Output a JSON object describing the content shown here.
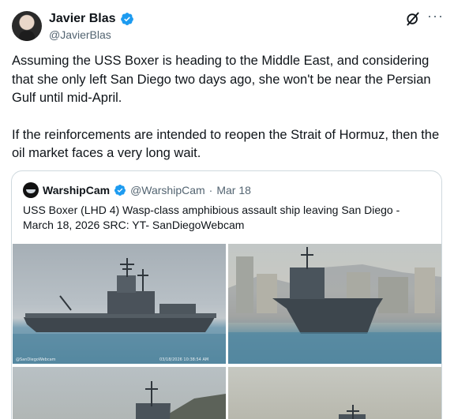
{
  "author": {
    "name": "Javier Blas",
    "handle": "@JavierBlas"
  },
  "tweet": {
    "paragraph1": "Assuming the USS Boxer is heading to the Middle East, and considering that she only left San Diego two days ago, she won't be near the Persian Gulf until mid-April.",
    "paragraph2": "If the reinforcements are intended to reopen the Strait of Hormuz, then the oil market faces a very long wait."
  },
  "quote": {
    "name": "WarshipCam",
    "handle": "@WarshipCam",
    "separator": "·",
    "date": "Mar 18",
    "text": "USS Boxer (LHD 4) Wasp-class amphibious assault ship leaving San Diego - March 18, 2026     SRC: YT- SanDiegoWebcam",
    "watermark_left": "@SanDiegoWebcam",
    "watermark_right": "03/18/2026 10:38:54 AM"
  },
  "icons": {
    "verified": "verified-badge-icon",
    "grok": "grok-icon",
    "more": "more-options-icon"
  },
  "colors": {
    "verified_blue": "#1d9bf0",
    "text_primary": "#0f1419",
    "text_secondary": "#536471",
    "border": "#cfd9de"
  }
}
